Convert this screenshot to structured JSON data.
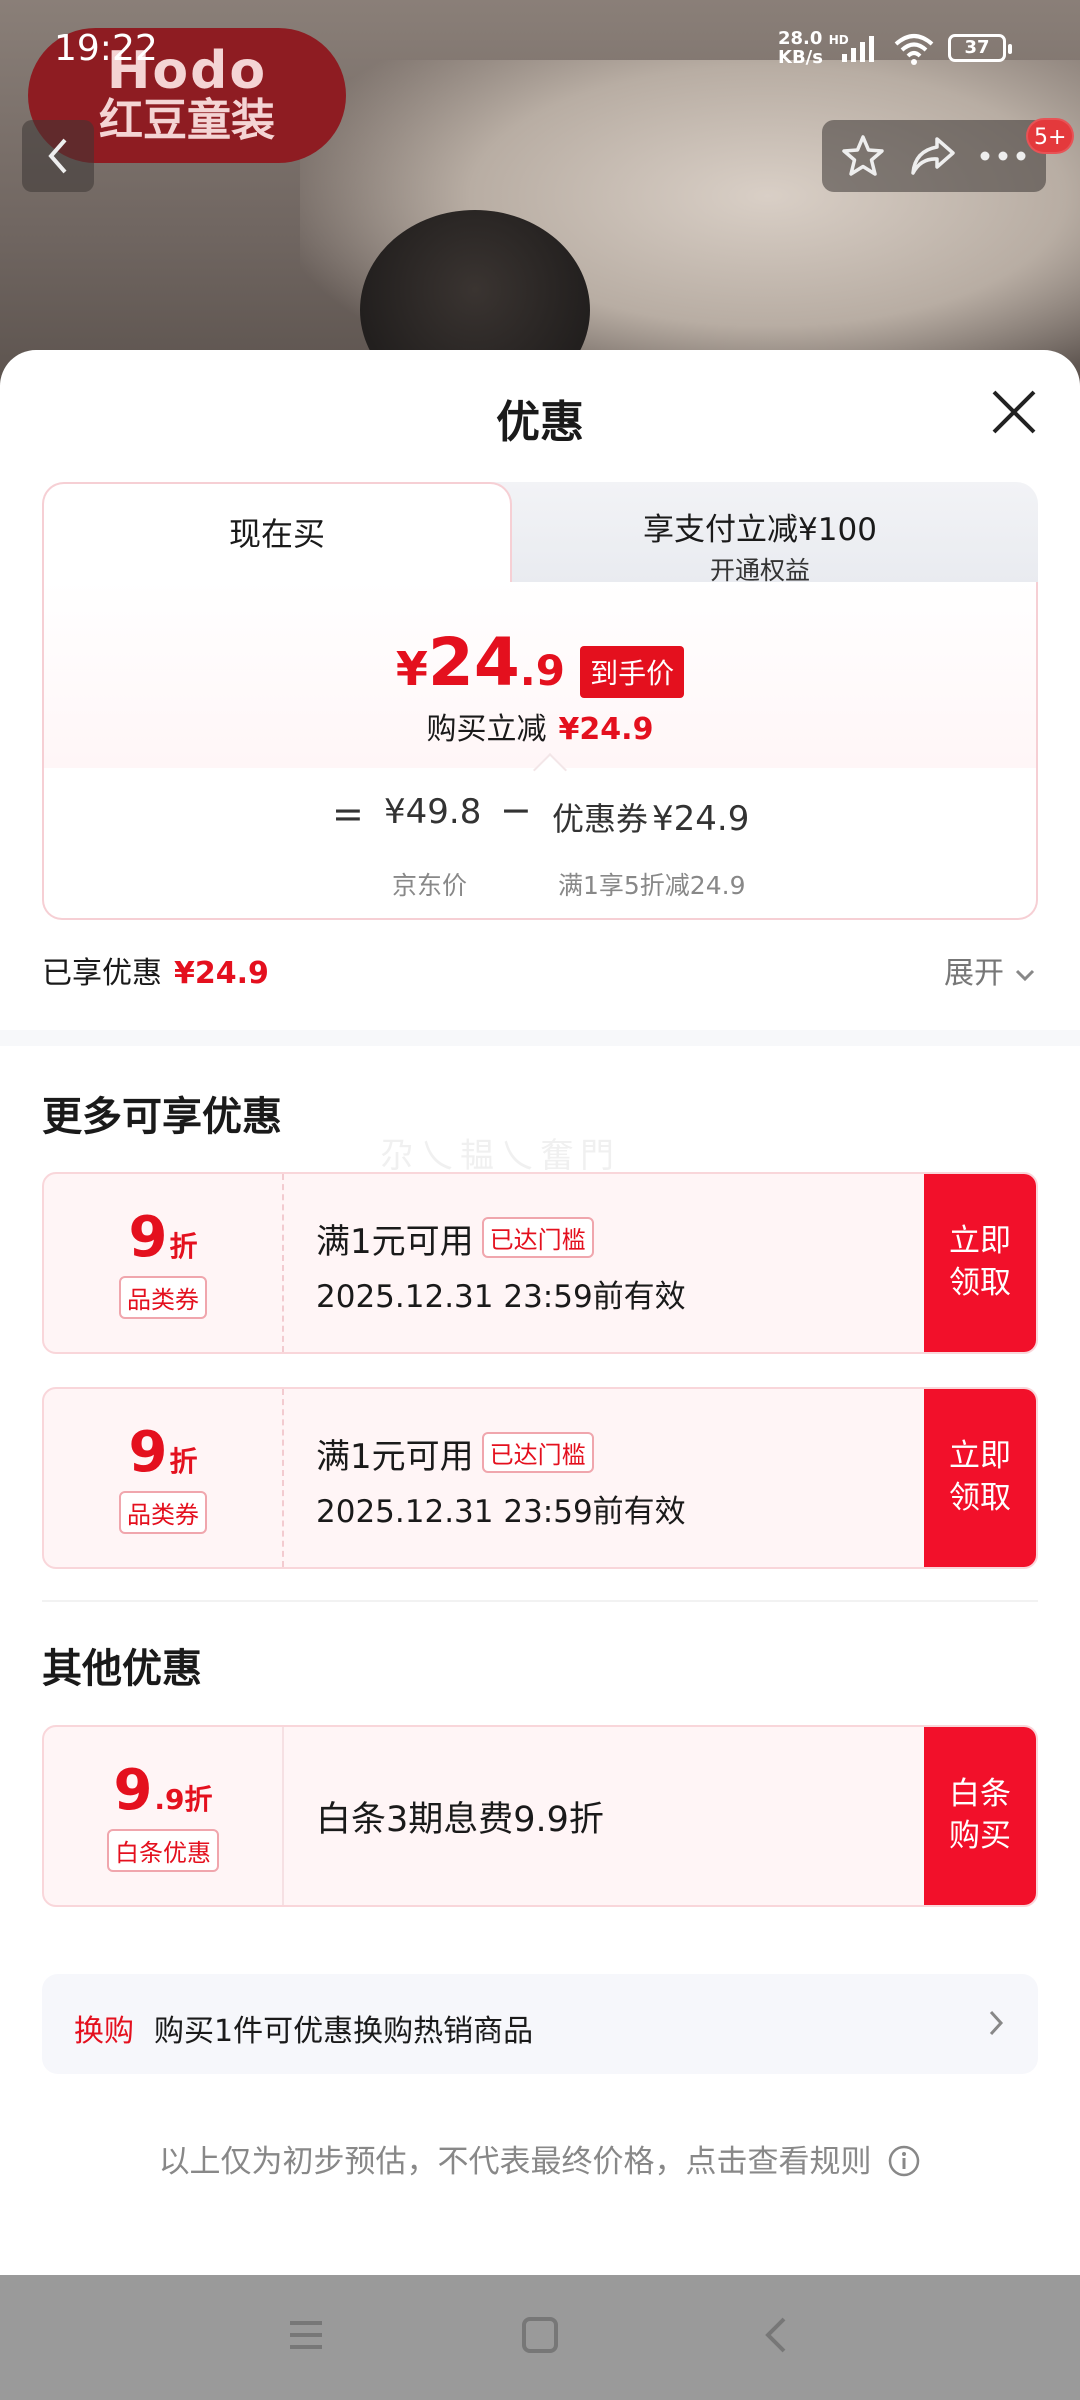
{
  "status_bar": {
    "time": "19:22",
    "net_speed_value": "28.0",
    "net_speed_unit": "KB/s",
    "net_tag": "HD",
    "battery": "37"
  },
  "brand": {
    "logo": "Hodo",
    "name": "红豆童装"
  },
  "top_actions": {
    "cart_badge": "5+"
  },
  "sheet": {
    "title": "优惠",
    "tabs": {
      "active": "现在买",
      "inactive_line1": "享支付立减¥100",
      "inactive_line2": "开通权益"
    },
    "price": {
      "currency": "¥",
      "integer": "24",
      "decimal": ".9",
      "final_tag": "到手价",
      "instant_label": "购买立减",
      "instant_value": "¥24.9"
    },
    "calc": {
      "equals": "=",
      "jd_price": "¥49.8",
      "minus": "−",
      "coupon_label": "优惠券",
      "coupon_value": "¥24.9",
      "jd_label": "京东价",
      "coupon_desc": "满1享5折减24.9"
    },
    "enjoyed": {
      "label": "已享优惠",
      "value": "¥24.9"
    },
    "expand_label": "展开",
    "more_title": "更多可享优惠",
    "watermark": "尕乀韫乀奮門",
    "coupons": [
      {
        "big": "9",
        "unit": "折",
        "type": "品类券",
        "condition": "满1元可用",
        "status": "已达门槛",
        "validity": "2025.12.31 23:59前有效",
        "action_l1": "立即",
        "action_l2": "领取"
      },
      {
        "big": "9",
        "unit": "折",
        "type": "品类券",
        "condition": "满1元可用",
        "status": "已达门槛",
        "validity": "2025.12.31 23:59前有效",
        "action_l1": "立即",
        "action_l2": "领取"
      }
    ],
    "other_title": "其他优惠",
    "baitiao": {
      "big": "9",
      "unit": ".9折",
      "type": "白条优惠",
      "desc": "白条3期息费9.9折",
      "action_l1": "白条",
      "action_l2": "购买"
    },
    "swap": {
      "key": "换购",
      "text": "购买1件可优惠换购热销商品"
    },
    "disclaimer": "以上仅为初步预估，不代表最终价格，点击查看规则"
  },
  "colors": {
    "accent": "#e4101e",
    "button_red": "#f2102a",
    "coupon_bg": "#fff5f6"
  }
}
